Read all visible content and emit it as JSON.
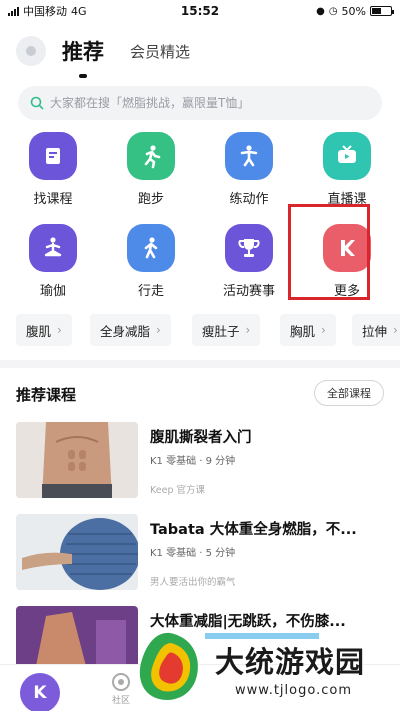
{
  "status_bar": {
    "carrier": "中国移动",
    "network": "4G",
    "time": "15:52",
    "battery": "50%",
    "battery_level": 0.5
  },
  "header": {
    "tab_active": "推荐",
    "tab_secondary": "会员精选"
  },
  "search": {
    "placeholder": "大家都在搜「燃脂挑战，赢限量T恤」"
  },
  "grid": [
    {
      "label": "找课程",
      "icon": "course-icon",
      "color": "#6c55d8"
    },
    {
      "label": "跑步",
      "icon": "running-icon",
      "color": "#36c184"
    },
    {
      "label": "练动作",
      "icon": "exercise-icon",
      "color": "#4e8be8"
    },
    {
      "label": "直播课",
      "icon": "live-tv-icon",
      "color": "#2fc5b0"
    },
    {
      "label": "瑜伽",
      "icon": "yoga-icon",
      "color": "#6c55d8"
    },
    {
      "label": "行走",
      "icon": "walking-icon",
      "color": "#4e8be8"
    },
    {
      "label": "活动赛事",
      "icon": "trophy-icon",
      "color": "#6c55d8"
    },
    {
      "label": "更多",
      "icon": "keep-k-icon",
      "color": "#ea5e6a"
    }
  ],
  "tags": [
    "腹肌",
    "全身减脂",
    "瘦肚子",
    "胸肌",
    "拉伸"
  ],
  "recommend": {
    "title": "推荐课程",
    "all_button": "全部课程",
    "courses": [
      {
        "name": "腹肌撕裂者入门",
        "meta": "K1 零基础 · 9 分钟",
        "source": "Keep 官方课"
      },
      {
        "name": "Tabata 大体重全身燃脂，不...",
        "meta": "K1 零基础 · 5 分钟",
        "source": "男人要活出你的霸气"
      },
      {
        "name": "大体重减脂|无跳跃，不伤膝...",
        "meta": "",
        "source": ""
      }
    ]
  },
  "bottom_nav": {
    "home_icon": "K",
    "community_label": "社区"
  },
  "watermark": {
    "title": "大统游戏园",
    "url": "www.tjlogo.com"
  }
}
